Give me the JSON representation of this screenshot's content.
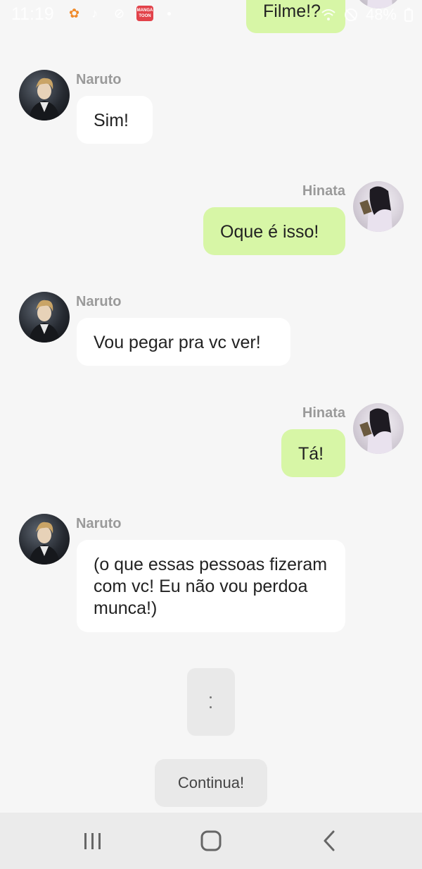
{
  "status_bar": {
    "time": "11:19",
    "battery": "48%"
  },
  "messages": [
    {
      "side": "right",
      "sender": "",
      "text": "Filme!?",
      "partial": true
    },
    {
      "side": "left",
      "sender": "Naruto",
      "text": "Sim!"
    },
    {
      "side": "right",
      "sender": "Hinata",
      "text": "Oque é isso!"
    },
    {
      "side": "left",
      "sender": "Naruto",
      "text": "Vou pegar pra vc ver!"
    },
    {
      "side": "right",
      "sender": "Hinata",
      "text": "Tá!"
    },
    {
      "side": "left",
      "sender": "Naruto",
      "text": "(o que essas pessoas fizeram com vc! Eu não vou perdoa munca!)"
    }
  ],
  "typing_indicator": "..",
  "continue_button": "Continua!",
  "nav": {
    "recent": "recent-apps-icon",
    "home": "home-icon",
    "back": "back-icon"
  },
  "colors": {
    "background": "#f6f6f6",
    "outgoing_bubble": "#d7f6a6",
    "incoming_bubble": "#ffffff",
    "sender_name": "#9a9a9a",
    "nav_bar": "#ebebeb"
  }
}
